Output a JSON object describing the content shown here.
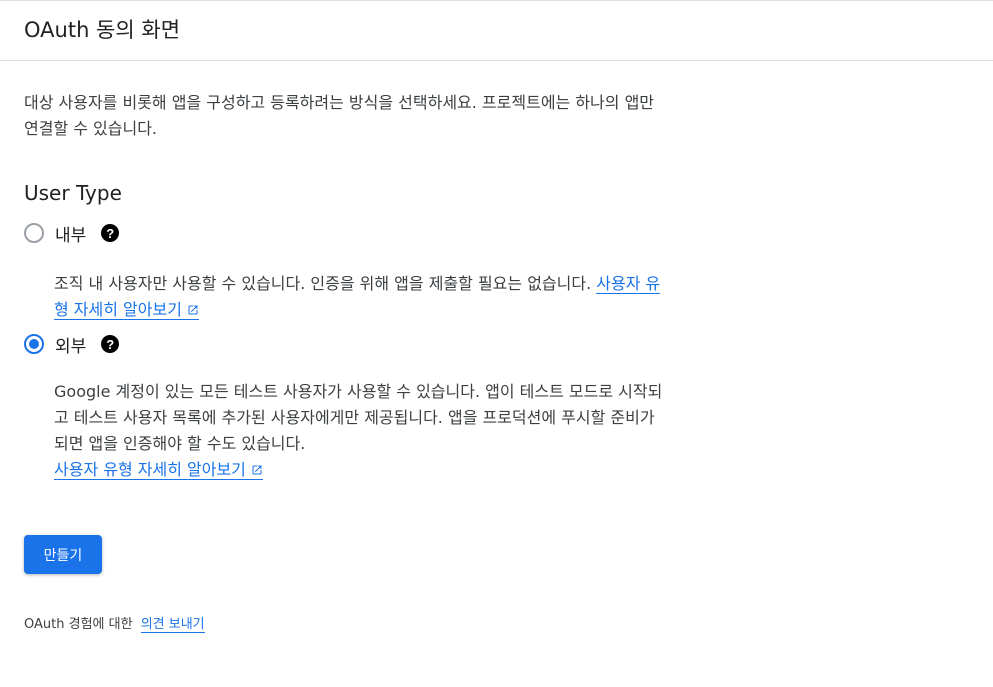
{
  "header": {
    "title": "OAuth 동의 화면"
  },
  "intro": "대상 사용자를 비롯해 앱을 구성하고 등록하려는 방식을 선택하세요. 프로젝트에는 하나의 앱만 연결할 수 있습니다.",
  "user_type": {
    "title": "User Type",
    "options": [
      {
        "label": "내부",
        "checked": false,
        "description": "조직 내 사용자만 사용할 수 있습니다. 인증을 위해 앱을 제출할 필요는 없습니다.",
        "link": "사용자 유형 자세히 알아보기"
      },
      {
        "label": "외부",
        "checked": true,
        "description": "Google 계정이 있는 모든 테스트 사용자가 사용할 수 있습니다. 앱이 테스트 모드로 시작되고 테스트 사용자 목록에 추가된 사용자에게만 제공됩니다. 앱을 프로덕션에 푸시할 준비가 되면 앱을 인증해야 할 수도 있습니다.",
        "link": "사용자 유형 자세히 알아보기"
      }
    ],
    "help_icon": "help-circle-icon",
    "external_icon": "open-in-new-icon"
  },
  "actions": {
    "create_label": "만들기"
  },
  "feedback": {
    "text": "OAuth 경험에 대한",
    "link": "의견 보내기"
  },
  "colors": {
    "accent": "#1a73e8",
    "text": "#202124",
    "border": "#e0e0e0"
  }
}
